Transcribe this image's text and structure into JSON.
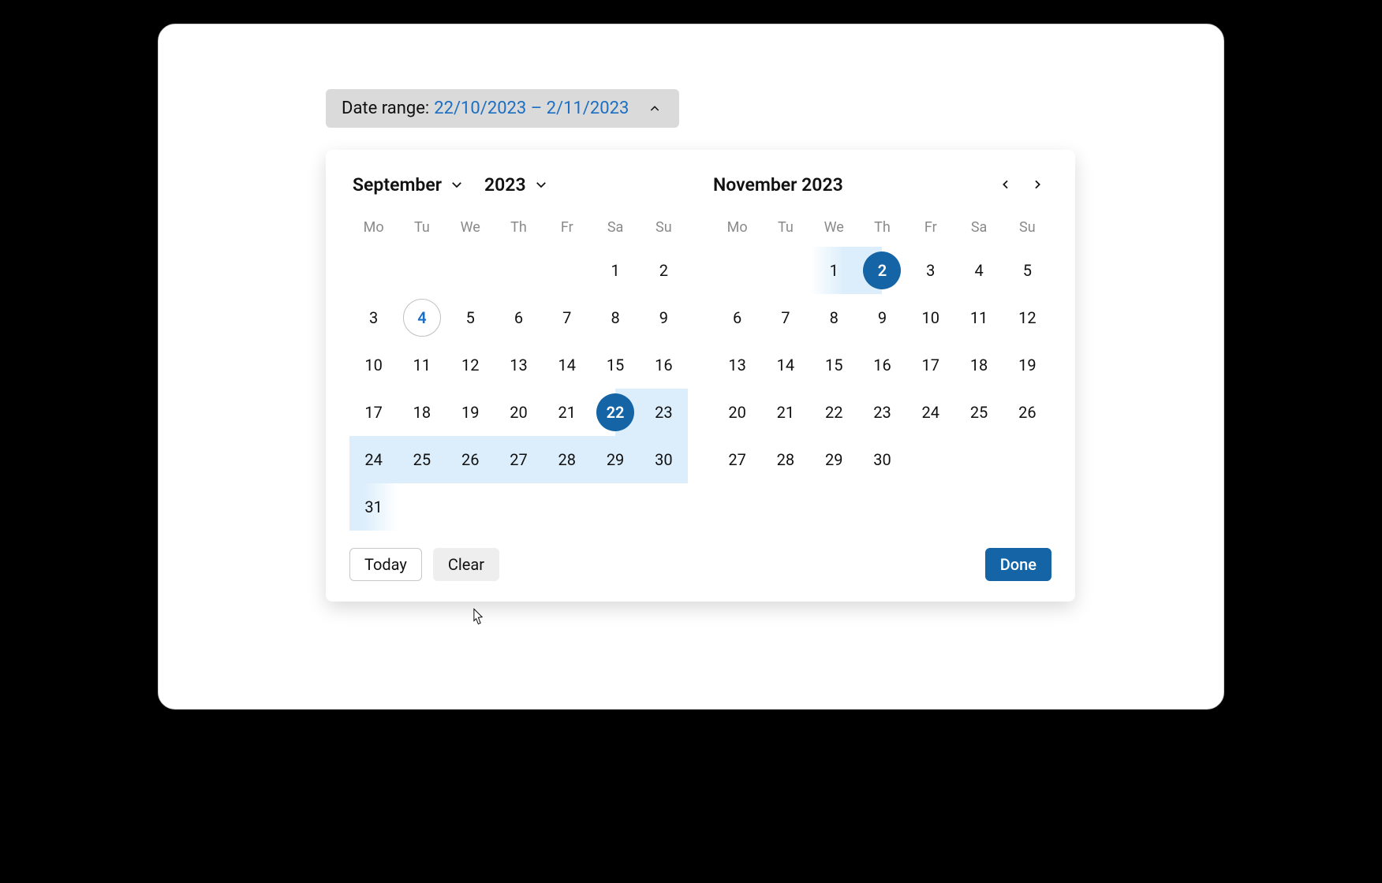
{
  "colors": {
    "accent": "#1565a6",
    "range": "#dceefb"
  },
  "trigger": {
    "label": "Date range:",
    "value": "22/10/2023 – 2/11/2023"
  },
  "dowShort": [
    "Mo",
    "Tu",
    "We",
    "Th",
    "Fr",
    "Sa",
    "Su"
  ],
  "left": {
    "monthLabel": "September",
    "yearLabel": "2023",
    "firstDow": 5,
    "daysInMonth": 31,
    "today": 4,
    "rangeStart": 22,
    "rangeContinues": true
  },
  "right": {
    "title": "November 2023",
    "firstDow": 2,
    "daysInMonth": 30,
    "rangeEnd": 2,
    "rangeStartsBefore": true
  },
  "footer": {
    "today": "Today",
    "clear": "Clear",
    "done": "Done"
  }
}
